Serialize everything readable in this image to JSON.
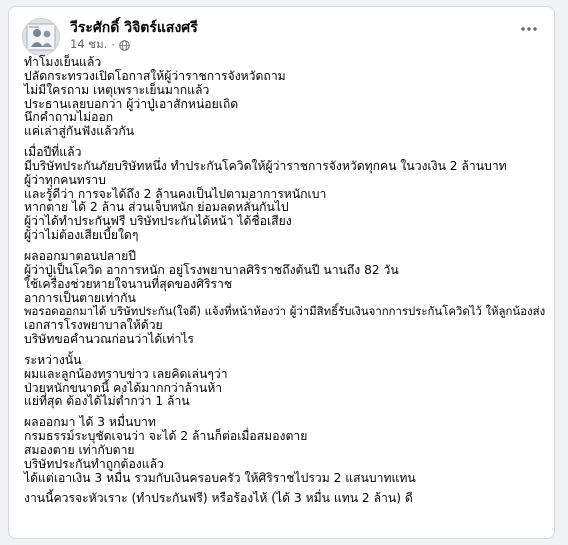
{
  "post": {
    "author": "วีระศักดิ์ วิจิตร์แสงศรี",
    "time": "14 ชม.",
    "separator": "·",
    "privacy_icon": "globe-icon",
    "more_icon": "more-options-icon",
    "paragraphs": [
      [
        "ทำโมงเย็นแล้ว",
        "ปลัดกระทรวงเปิดโอกาสให้ผู้ว่าราชการจังหวัดถาม",
        "ไม่มีใครถาม เหตุเพราะเย็นมากแล้ว",
        "ประธานเลยบอกว่า ผู้ว่าปู่เอาสักหน่อยเถิด",
        "นึกคำถามไม่ออก",
        "แค่เล่าสู่กันฟังแล้วกัน"
      ],
      [
        "เมื่อปีที่แล้ว",
        "มีบริษัทประกันภัยบริษัทหนึ่ง ทำประกันโควิดให้ผู้ว่าราชการจังหวัดทุกคน ในวงเงิน 2 ล้านบาท",
        "ผู้ว่าทุกคนทราบ",
        "และรู้ดีว่า การจะได้ถึง 2 ล้านคงเป็นไปตามอาการหนักเบา",
        "หากตาย ได้ 2 ล้าน ส่วนเจ็บหนัก ย่อมลดหลั่นกันไป",
        "ผู้ว่าได้ทำประกันฟรี บริษัทประกันได้หน้า ได้ชื่อเสียง",
        "ผู้ว่าไม่ต้องเสียเบี้ยใดๆ"
      ],
      [
        "ผลออกมาตอนปลายปี",
        "ผู้ว่าปู่เป็นโควิด อาการหนัก อยู่โรงพยาบาลศิริราชถึงต้นปี นานถึง 82 วัน",
        "ใช้เครื่องช่วยหายใจนานที่สุดของศิริราช",
        "อาการเป็นตายเท่ากัน",
        "พอรอดออกมาได้ บริษัทประกัน(ใจดี) แจ้งที่หน้าห้องว่า ผู้ว่ามีสิทธิ์รับเงินจากการประกันโควิดไว้ ให้ลูกน้องส่ง",
        "เอกสารโรงพยาบาลให้ด้วย",
        "บริษัทขอคำนวณก่อนว่าได้เท่าไร"
      ],
      [
        "ระหว่างนั้น",
        "ผมและลูกน้องทราบข่าว เลยคิดเล่นๆว่า",
        "ป่วยหนักขนาดนี้ คงได้มากกว่าล้านห้า",
        "แย่ที่สุด ต้องได้ไม่ต่ำกว่า 1 ล้าน"
      ],
      [
        "ผลออกมา ได้ 3 หมื่นบาท",
        "กรมธรรม์ระบุชัดเจนว่า จะได้ 2 ล้านก็ต่อเมื่อสมองตาย",
        "สมองตาย เท่ากับตาย",
        "บริษัทประกันทำถูกต้องแล้ว",
        "ได้แต่เอาเงิน 3 หมื่น รวมกับเงินครอบครัว ให้ศิริราชไปรวม 2 แสนบาทแทน"
      ],
      [
        "งานนี้ควรจะหัวเราะ (ทำประกันฟรี) หรือร้องไห้ (ได้ 3 หมื่น แทน 2 ล้าน) ดี"
      ]
    ]
  }
}
